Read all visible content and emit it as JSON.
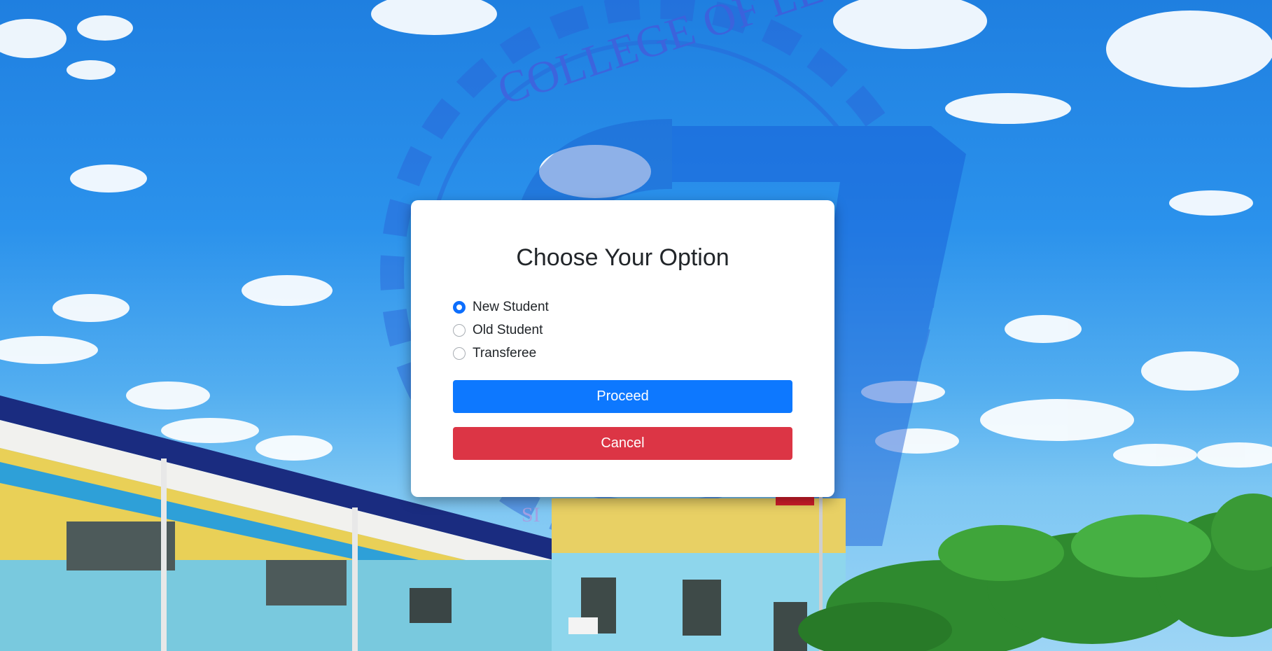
{
  "background": {
    "logo_text": "COLLEGE OF LEARNING",
    "logo_fragment": "SI"
  },
  "modal": {
    "title": "Choose Your Option",
    "options": [
      {
        "label": "New Student",
        "checked": true
      },
      {
        "label": "Old Student",
        "checked": false
      },
      {
        "label": "Transferee",
        "checked": false
      }
    ],
    "proceed_label": "Proceed",
    "cancel_label": "Cancel"
  },
  "colors": {
    "primary": "#0d78ff",
    "danger": "#dc3545",
    "radio_checked": "#0d6efd",
    "text": "#212529"
  }
}
